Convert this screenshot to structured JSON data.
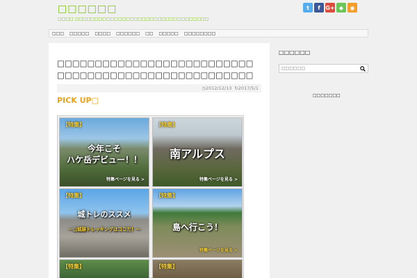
{
  "site": {
    "title": "□□□□□□",
    "description": "□□□□ □□□□□□□□□□□□□□□□□□□□□□□□□□□□□□□□□□"
  },
  "social": [
    {
      "icon": "twitter-icon",
      "glyph": "t",
      "color": "#55acee"
    },
    {
      "icon": "facebook-icon",
      "glyph": "f",
      "color": "#3b5998"
    },
    {
      "icon": "google-plus-icon",
      "glyph": "G+",
      "color": "#dd4b39"
    },
    {
      "icon": "feedly-icon",
      "glyph": "◆",
      "color": "#6cc655"
    },
    {
      "icon": "rss-icon",
      "glyph": "◉",
      "color": "#f59d2a"
    }
  ],
  "nav": {
    "items": [
      "□□□",
      "□□□□□",
      "□□□□",
      "□□□□□□",
      "□□",
      "□□□□□",
      "□□□□□□□□"
    ]
  },
  "post": {
    "title": "□□□□□□□□□□□□□□□□□□□□□□□□□□□□□□□□□□□□□□□□□□□□□□□□□□□□□□",
    "published": "◷2012/12/13",
    "updated": "↻2017/5/1"
  },
  "pickup": {
    "heading": "PICK UP□",
    "tiles": [
      {
        "tag": "【特集】",
        "headline": "今年こそ\nハケ岳デビュー！！",
        "link": "特集ページを見る >"
      },
      {
        "tag": "【特集】",
        "headline": "南アルプス",
        "link": "特集ページを見る >"
      },
      {
        "tag": "【特集】",
        "headline": "城トレのススメ",
        "sub": "～山城跡トレッキングはココだ！～",
        "link": ""
      },
      {
        "tag": "【特集】",
        "headline": "島へ行こう！",
        "link": "特集ページを見る >"
      },
      {
        "tag": "【特集】",
        "headline": "",
        "link": ""
      },
      {
        "tag": "【特集】",
        "headline": "",
        "link": ""
      }
    ]
  },
  "sidebar": {
    "search_title": "□□□□□□",
    "search_placeholder": "□□□□□□",
    "widget_title": "□□□□□□□"
  }
}
